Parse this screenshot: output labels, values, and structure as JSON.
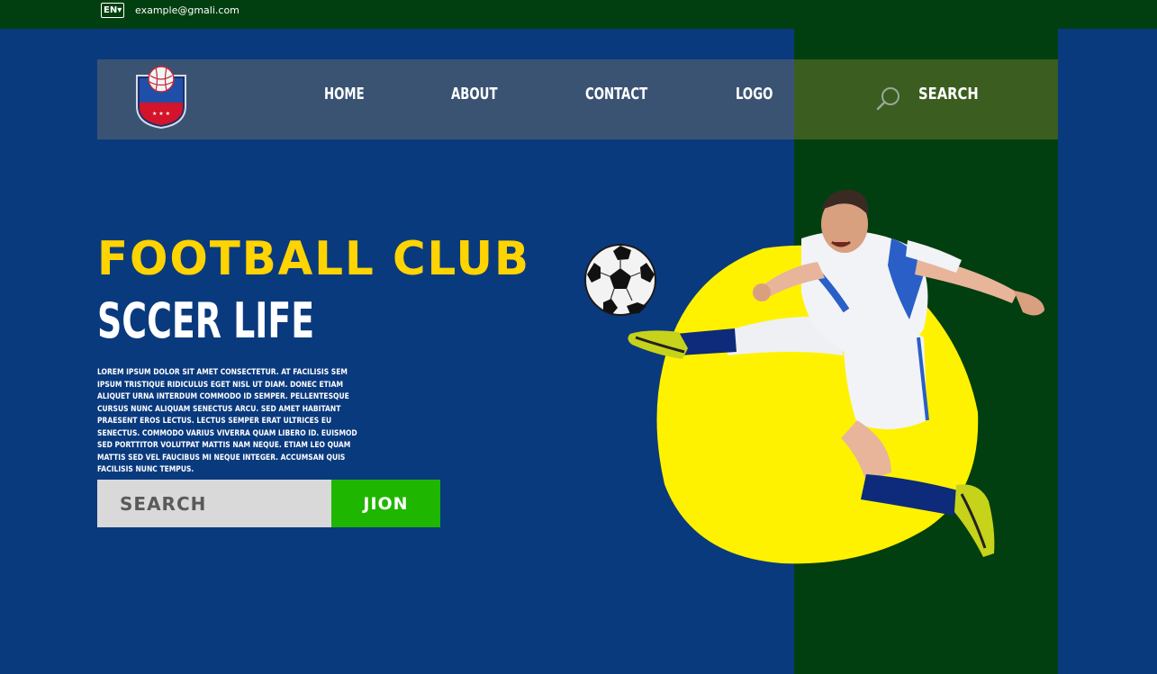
{
  "topbar": {
    "language": "EN▾",
    "email": "example@gmali.com"
  },
  "nav": {
    "links": [
      {
        "label": "HOME"
      },
      {
        "label": "ABOUT"
      },
      {
        "label": "CONTACT"
      },
      {
        "label": "LOGO"
      }
    ],
    "search_label": "SEARCH",
    "icons": {
      "logo": "football-club-shield-icon",
      "search": "search-icon"
    }
  },
  "hero": {
    "title": "FOOTBALL CLUB",
    "subtitle": "SCCER LIFE",
    "body": "LOREM IPSUM DOLOR SIT AMET CONSECTETUR. AT FACILISIS SEM IPSUM TRISTIQUE RIDICULUS EGET NISL UT DIAM. DONEC ETIAM ALIQUET URNA INTERDUM COMMODO ID SEMPER. PELLENTESQUE CURSUS NUNC ALIQUAM SENECTUS ARCU. SED AMET HABITANT PRAESENT EROS LECTUS. LECTUS SEMPER ERAT ULTRICES EU SENECTUS. COMMODO VARIUS VIVERRA QUAM LIBERO ID. EUISMOD SED PORTTITOR VOLUTPAT MATTIS NAM NEQUE. ETIAM LEO QUAM MATTIS SED VEL FAUCIBUS MI NEQUE INTEGER. ACCUMSAN QUIS FACILISIS NUNC TEMPUS."
  },
  "signup": {
    "search_placeholder": "SEARCH",
    "join_label": "JION"
  },
  "colors": {
    "background": "#0a3a7e",
    "topbar": "#023f10",
    "green_panel": "#023f10",
    "nav": "#3a5373",
    "nav_search": "#3b5d1f",
    "title_yellow": "#ffd400",
    "blob_yellow": "#fff200",
    "join_green": "#1fb600",
    "search_gray": "#d9d9d9"
  }
}
